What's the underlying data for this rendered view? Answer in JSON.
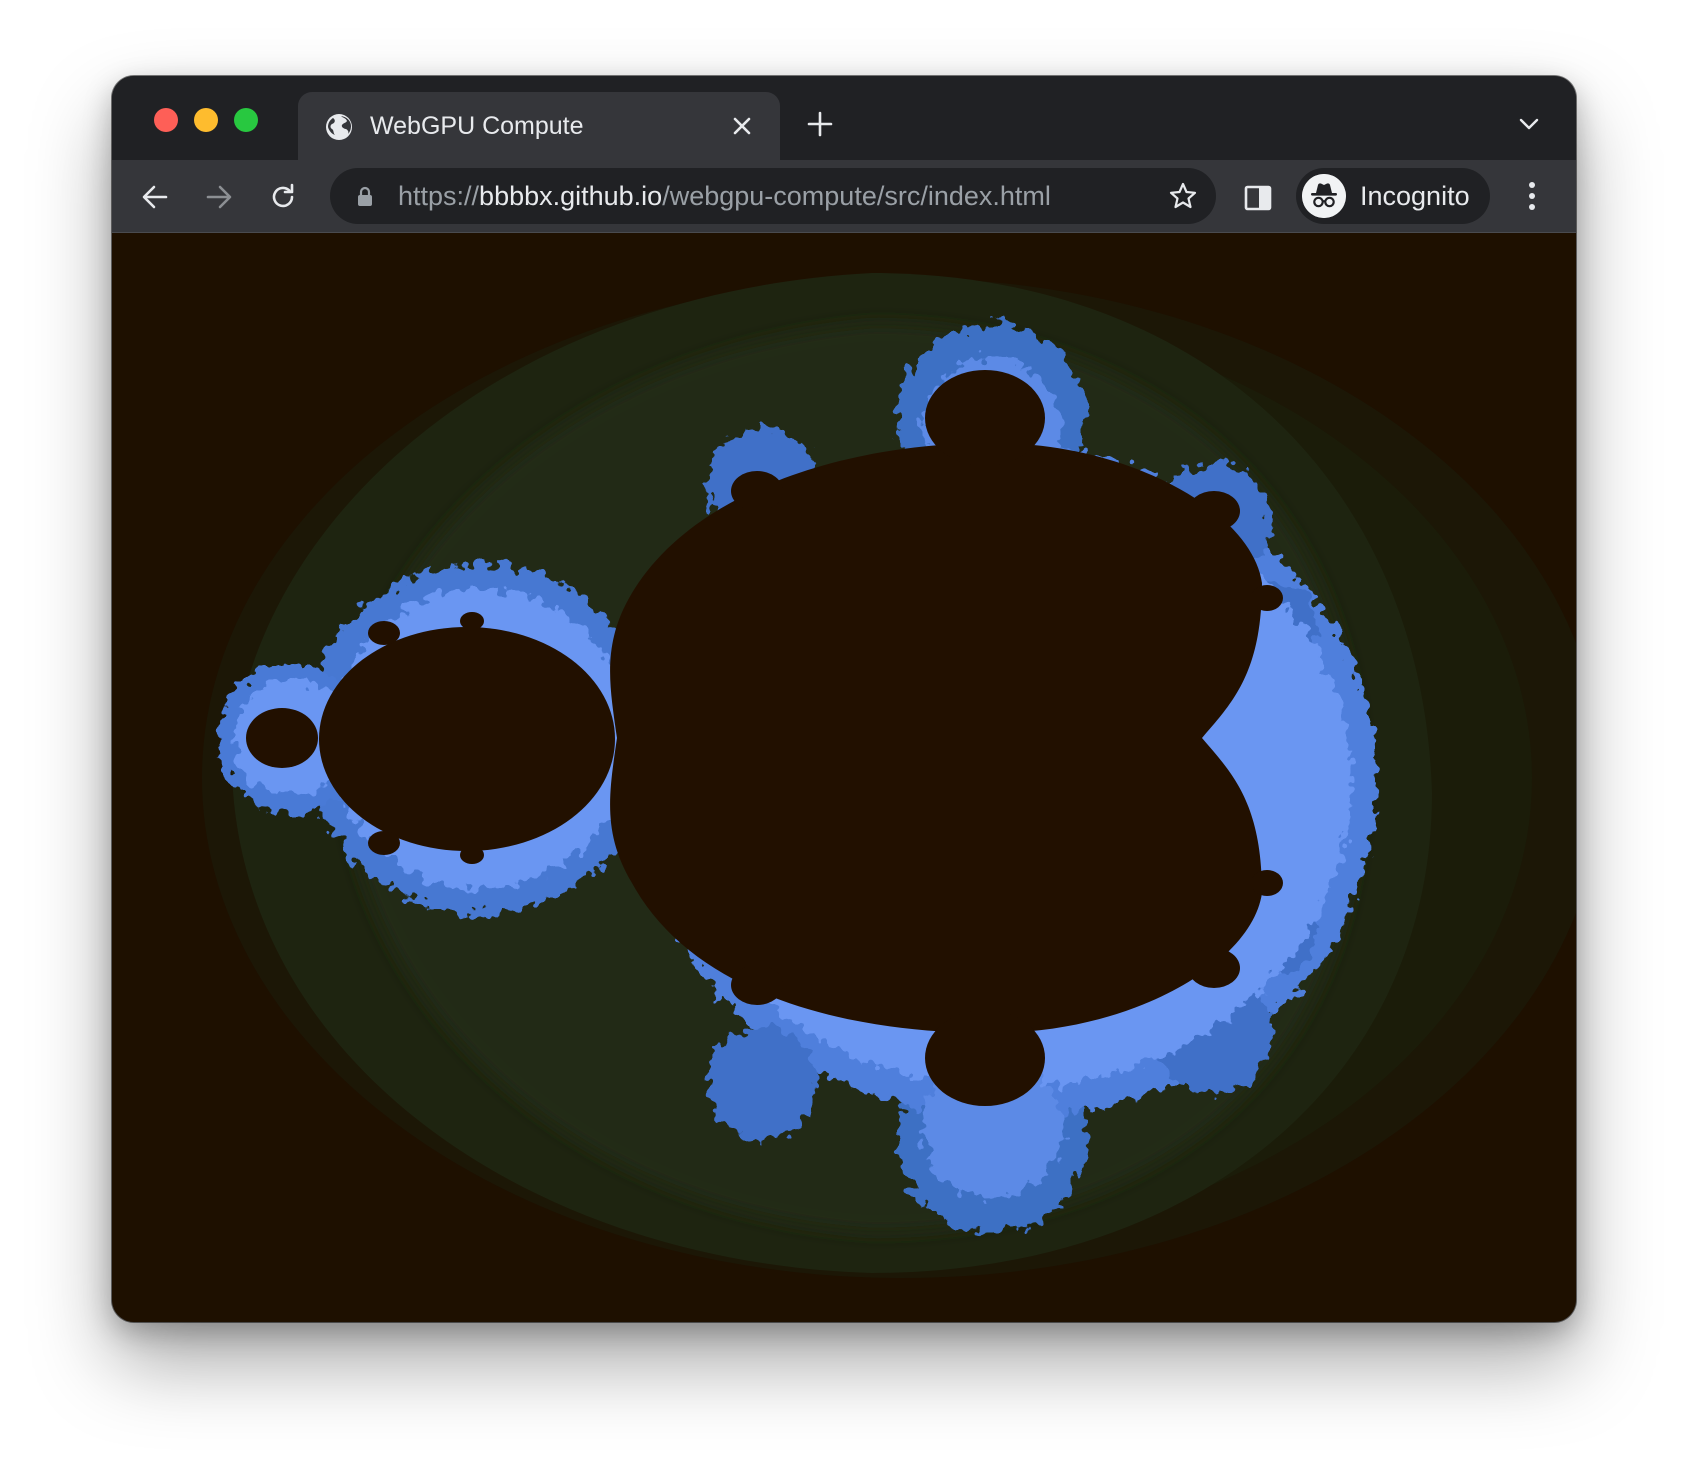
{
  "window": {
    "controls": [
      "close",
      "minimize",
      "zoom"
    ]
  },
  "tab": {
    "title": "WebGPU Compute",
    "favicon": "globe-icon",
    "close_icon": "close-icon"
  },
  "toolbar": {
    "url_scheme": "https://",
    "url_host": "bbbbx.github.io",
    "url_path": "/webgpu-compute/src/index.html",
    "profile_label": "Incognito"
  },
  "colors": {
    "tabstrip": "#202124",
    "toolbar": "#35363a",
    "fractal_interior": "#221000",
    "fractal_background": "#1e1000",
    "fractal_edge": "#5a86ee"
  }
}
